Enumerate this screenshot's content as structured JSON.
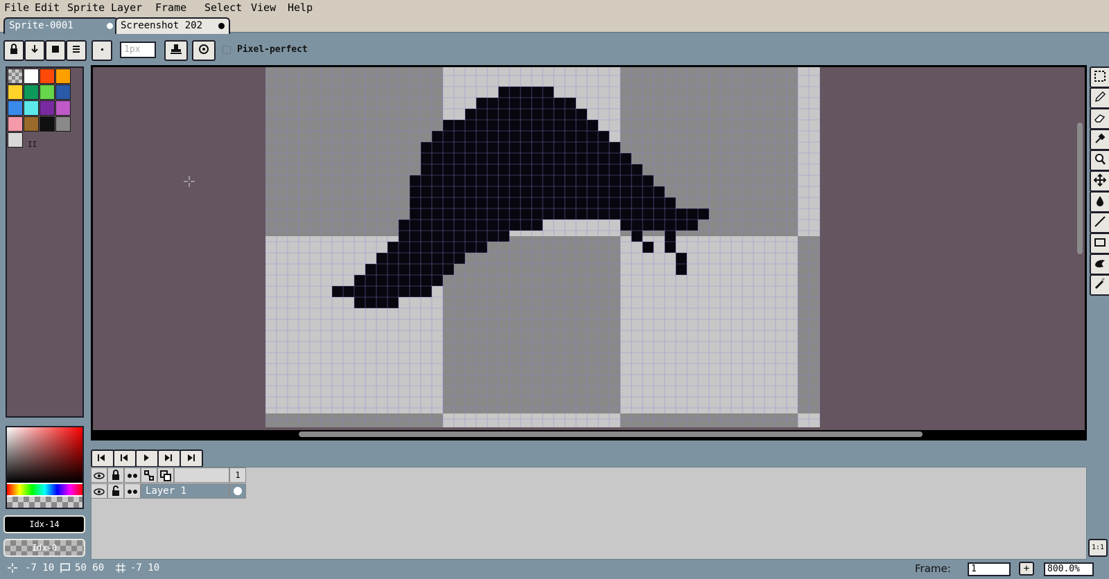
{
  "menu": {
    "items": [
      "File",
      "Edit",
      "Sprite",
      "Layer",
      "Frame",
      "Select",
      "View",
      "Help"
    ]
  },
  "tabs": [
    {
      "label": "Sprite-0001",
      "active": true
    },
    {
      "label": "Screenshot 202",
      "active": false
    }
  ],
  "toolbar": {
    "brush_size_value": "1px",
    "pixel_perfect_label": "Pixel-perfect",
    "pixel_perfect_checked": false
  },
  "palette": {
    "colors": [
      "#ffffff",
      "#ff4a0a",
      "#ffa000",
      "#ffd22a",
      "#0e9a5a",
      "#66d64a",
      "#2a5aa8",
      "#3a8aea",
      "#5de8ea",
      "#7a2aa0",
      "#c05ac8",
      "#f59aaa",
      "#9a6a2a",
      "#101010",
      "#8a8a8a",
      "#d8d8d8"
    ],
    "counter_label": "II"
  },
  "color_indicators": {
    "fg_label": "Idx-14",
    "bg_label": "Idx-0"
  },
  "timeline": {
    "frame_header": "1",
    "layers": [
      {
        "name": "Layer 1"
      }
    ]
  },
  "status": {
    "cursor_pos": "-7 10",
    "sprite_size": "50 60",
    "grid_pos": "-7 10",
    "frame_label": "Frame:",
    "frame_value": "1",
    "add_frame": "+",
    "zoom_value": "800.0%",
    "zoom_reset": "1:1"
  },
  "colors": {
    "workspace_bg": "#645560",
    "checker_light": "#c7c7c7",
    "checker_dark": "#898989",
    "grid_line": "#8a85d8",
    "ink": "#08060e",
    "ui_bg": "#7d93a1",
    "menu_bg": "#d3cbbe"
  }
}
